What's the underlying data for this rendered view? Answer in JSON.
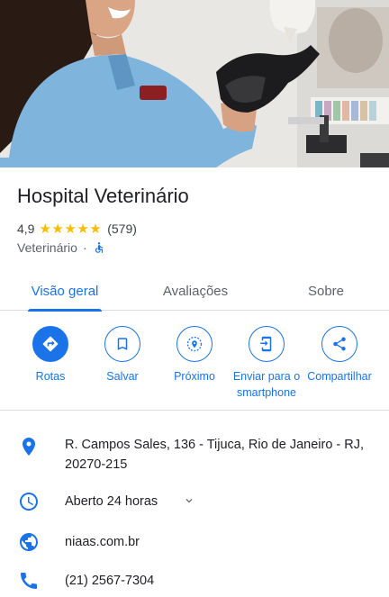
{
  "place": {
    "name": "Hospital Veterinário",
    "rating": "4,9",
    "stars": 5,
    "review_count": "(579)",
    "category": "Veterinário",
    "separator": "·"
  },
  "tabs": [
    {
      "label": "Visão geral",
      "active": true
    },
    {
      "label": "Avaliações",
      "active": false
    },
    {
      "label": "Sobre",
      "active": false
    }
  ],
  "actions": [
    {
      "label": "Rotas",
      "icon": "directions-icon"
    },
    {
      "label": "Salvar",
      "icon": "bookmark-icon"
    },
    {
      "label": "Próximo",
      "icon": "nearby-icon"
    },
    {
      "label": "Enviar para o smartphone",
      "icon": "send-to-phone-icon"
    },
    {
      "label": "Compartilhar",
      "icon": "share-icon"
    }
  ],
  "info": {
    "address": "R. Campos Sales, 136 - Tijuca, Rio de Janeiro - RJ, 20270-215",
    "hours": "Aberto 24 horas",
    "website": "niaas.com.br",
    "phone": "(21) 2567-7304"
  },
  "colors": {
    "accent": "#1a73e8",
    "star": "#fbbc04",
    "open": "#188038"
  }
}
